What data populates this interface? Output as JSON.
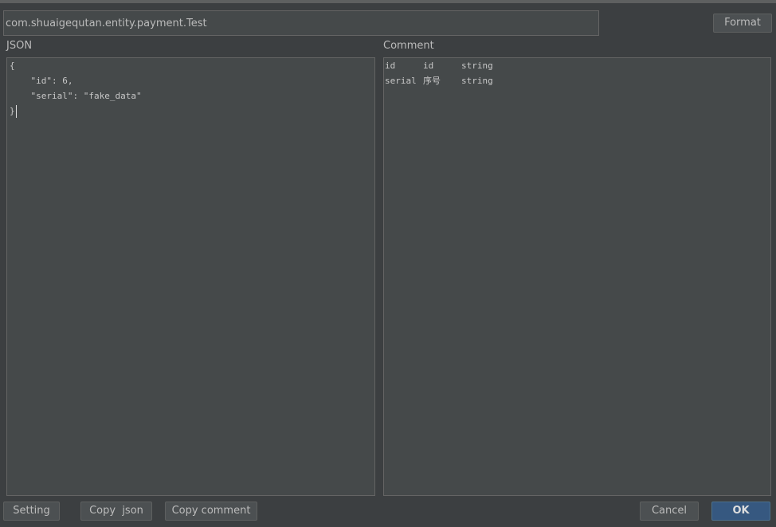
{
  "dialog": {
    "class_name_value": "com.shuaigequtan.entity.payment.Test",
    "format_label": "Format"
  },
  "json_panel": {
    "label": "JSON",
    "lines": [
      "{",
      "    \"id\": 6,",
      "    \"serial\": \"fake_data\"",
      "}"
    ]
  },
  "comment_panel": {
    "label": "Comment",
    "rows": [
      [
        "id",
        "id",
        "string"
      ],
      [
        "serial",
        "序号",
        "string"
      ]
    ]
  },
  "footer": {
    "setting_label": "Setting",
    "copy_json_label": "Copy  json",
    "copy_comment_label": "Copy comment",
    "cancel_label": "Cancel",
    "ok_label": "OK"
  }
}
